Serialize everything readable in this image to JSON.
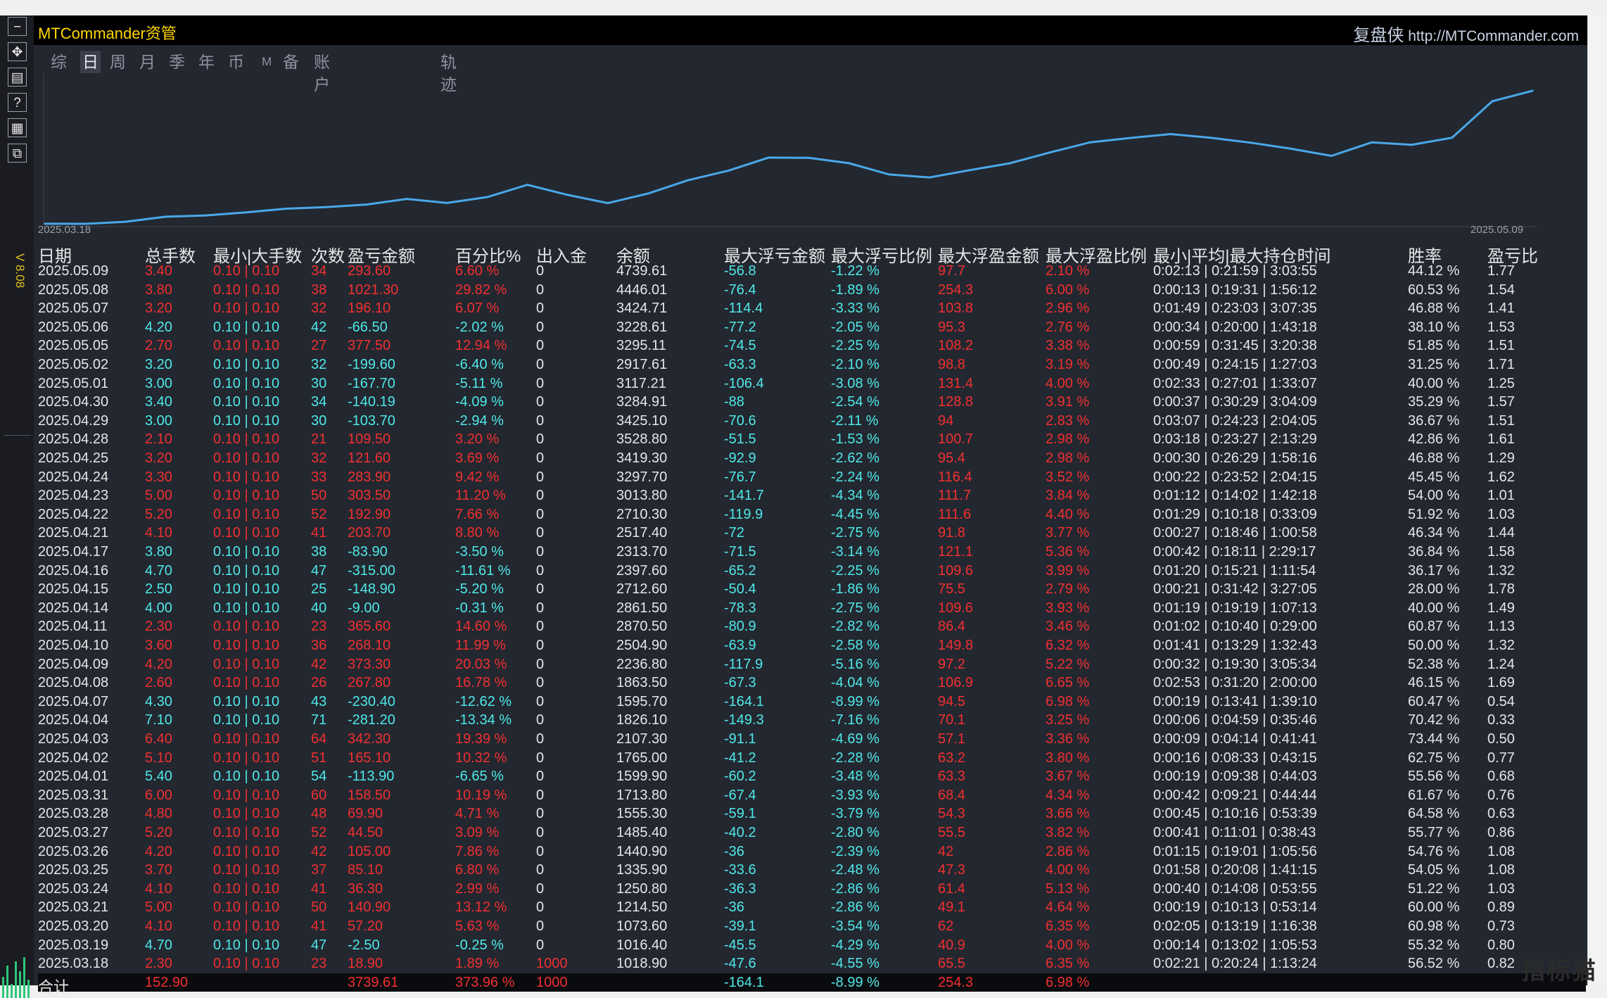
{
  "app": {
    "title": "MTCommander资管",
    "brand_name": "复盘侠",
    "brand_url": "http://MTCommander.com",
    "version": "V 8.08",
    "watermark": "指标猫"
  },
  "toolbar": [
    {
      "name": "minimize-icon",
      "glyph": "−"
    },
    {
      "name": "move-icon",
      "glyph": "✥"
    },
    {
      "name": "list-icon",
      "glyph": "▤"
    },
    {
      "name": "help-icon",
      "glyph": "?"
    },
    {
      "name": "grid-icon",
      "glyph": "▦"
    },
    {
      "name": "window-icon",
      "glyph": "⧉"
    }
  ],
  "tabs": [
    {
      "label": "综",
      "active": false
    },
    {
      "label": "日",
      "active": true
    },
    {
      "label": "周",
      "active": false
    },
    {
      "label": "月",
      "active": false
    },
    {
      "label": "季",
      "active": false
    },
    {
      "label": "年",
      "active": false
    },
    {
      "label": "币",
      "active": false
    },
    {
      "label": "M",
      "active": false
    },
    {
      "label": "备",
      "active": false
    },
    {
      "label": "账户",
      "active": false
    },
    {
      "label": "轨迹",
      "active": false
    }
  ],
  "chart_data": {
    "type": "line",
    "x_start_label": "2025.03.18",
    "x_end_label": "2025.05.09",
    "x": [
      "2025.03.18",
      "2025.03.19",
      "2025.03.20",
      "2025.03.21",
      "2025.03.24",
      "2025.03.25",
      "2025.03.26",
      "2025.03.27",
      "2025.03.28",
      "2025.03.31",
      "2025.04.01",
      "2025.04.02",
      "2025.04.03",
      "2025.04.04",
      "2025.04.07",
      "2025.04.08",
      "2025.04.09",
      "2025.04.10",
      "2025.04.11",
      "2025.04.14",
      "2025.04.15",
      "2025.04.16",
      "2025.04.17",
      "2025.04.21",
      "2025.04.22",
      "2025.04.23",
      "2025.04.24",
      "2025.04.25",
      "2025.04.28",
      "2025.04.29",
      "2025.04.30",
      "2025.05.01",
      "2025.05.02",
      "2025.05.05",
      "2025.05.06",
      "2025.05.07",
      "2025.05.08",
      "2025.05.09"
    ],
    "values": [
      1018.9,
      1016.4,
      1073.6,
      1214.5,
      1250.8,
      1335.9,
      1440.9,
      1485.4,
      1555.3,
      1713.8,
      1599.9,
      1765.0,
      2107.3,
      1826.1,
      1595.7,
      1863.5,
      2236.8,
      2504.9,
      2870.5,
      2861.5,
      2712.6,
      2397.6,
      2313.7,
      2517.4,
      2710.3,
      3013.8,
      3297.7,
      3419.3,
      3528.8,
      3425.1,
      3284.91,
      3117.21,
      2917.61,
      3295.11,
      3228.61,
      3424.71,
      4446.01,
      4739.61
    ],
    "line_color": "#4aa8e8",
    "grid": false
  },
  "table": {
    "headers": [
      "日期",
      "总手数",
      "最小|大手数",
      "次数",
      "盈亏金额",
      "百分比%",
      "出入金",
      "余额",
      "最大浮亏金额",
      "最大浮亏比例",
      "最大浮盈金额",
      "最大浮盈比例",
      "最小|平均|最大持仓时间",
      "胜率",
      "盈亏比"
    ],
    "rows": [
      [
        "2025.05.09",
        "3.40",
        "0.10 | 0.10",
        "34",
        "293.60",
        "6.60 %",
        "0",
        "4739.61",
        "-56.8",
        "-1.22 %",
        "97.7",
        "2.10 %",
        "0:02:13 | 0:21:59 | 3:03:55",
        "44.12 %",
        "1.77"
      ],
      [
        "2025.05.08",
        "3.80",
        "0.10 | 0.10",
        "38",
        "1021.30",
        "29.82 %",
        "0",
        "4446.01",
        "-76.4",
        "-1.89 %",
        "254.3",
        "6.00 %",
        "0:00:13 | 0:19:31 | 1:56:12",
        "60.53 %",
        "1.54"
      ],
      [
        "2025.05.07",
        "3.20",
        "0.10 | 0.10",
        "32",
        "196.10",
        "6.07 %",
        "0",
        "3424.71",
        "-114.4",
        "-3.33 %",
        "103.8",
        "2.96 %",
        "0:01:49 | 0:23:03 | 3:07:35",
        "46.88 %",
        "1.41"
      ],
      [
        "2025.05.06",
        "4.20",
        "0.10 | 0.10",
        "42",
        "-66.50",
        "-2.02 %",
        "0",
        "3228.61",
        "-77.2",
        "-2.05 %",
        "95.3",
        "2.76 %",
        "0:00:34 | 0:20:00 | 1:43:18",
        "38.10 %",
        "1.53"
      ],
      [
        "2025.05.05",
        "2.70",
        "0.10 | 0.10",
        "27",
        "377.50",
        "12.94 %",
        "0",
        "3295.11",
        "-74.5",
        "-2.25 %",
        "108.2",
        "3.38 %",
        "0:00:59 | 0:31:45 | 3:20:38",
        "51.85 %",
        "1.51"
      ],
      [
        "2025.05.02",
        "3.20",
        "0.10 | 0.10",
        "32",
        "-199.60",
        "-6.40 %",
        "0",
        "2917.61",
        "-63.3",
        "-2.10 %",
        "98.8",
        "3.19 %",
        "0:00:49 | 0:24:15 | 1:27:03",
        "31.25 %",
        "1.71"
      ],
      [
        "2025.05.01",
        "3.00",
        "0.10 | 0.10",
        "30",
        "-167.70",
        "-5.11 %",
        "0",
        "3117.21",
        "-106.4",
        "-3.08 %",
        "131.4",
        "4.00 %",
        "0:02:33 | 0:27:01 | 1:33:07",
        "40.00 %",
        "1.25"
      ],
      [
        "2025.04.30",
        "3.40",
        "0.10 | 0.10",
        "34",
        "-140.19",
        "-4.09 %",
        "0",
        "3284.91",
        "-88",
        "-2.54 %",
        "128.8",
        "3.91 %",
        "0:00:37 | 0:30:29 | 3:04:09",
        "35.29 %",
        "1.57"
      ],
      [
        "2025.04.29",
        "3.00",
        "0.10 | 0.10",
        "30",
        "-103.70",
        "-2.94 %",
        "0",
        "3425.10",
        "-70.6",
        "-2.11 %",
        "94",
        "2.83 %",
        "0:03:07 | 0:24:23 | 2:04:05",
        "36.67 %",
        "1.51"
      ],
      [
        "2025.04.28",
        "2.10",
        "0.10 | 0.10",
        "21",
        "109.50",
        "3.20 %",
        "0",
        "3528.80",
        "-51.5",
        "-1.53 %",
        "100.7",
        "2.98 %",
        "0:03:18 | 0:23:27 | 2:13:29",
        "42.86 %",
        "1.61"
      ],
      [
        "2025.04.25",
        "3.20",
        "0.10 | 0.10",
        "32",
        "121.60",
        "3.69 %",
        "0",
        "3419.30",
        "-92.9",
        "-2.62 %",
        "95.4",
        "2.98 %",
        "0:00:30 | 0:26:29 | 1:58:16",
        "46.88 %",
        "1.29"
      ],
      [
        "2025.04.24",
        "3.30",
        "0.10 | 0.10",
        "33",
        "283.90",
        "9.42 %",
        "0",
        "3297.70",
        "-76.7",
        "-2.24 %",
        "116.4",
        "3.52 %",
        "0:00:22 | 0:23:52 | 2:04:15",
        "45.45 %",
        "1.62"
      ],
      [
        "2025.04.23",
        "5.00",
        "0.10 | 0.10",
        "50",
        "303.50",
        "11.20 %",
        "0",
        "3013.80",
        "-141.7",
        "-4.34 %",
        "111.7",
        "3.84 %",
        "0:01:12 | 0:14:02 | 1:42:18",
        "54.00 %",
        "1.01"
      ],
      [
        "2025.04.22",
        "5.20",
        "0.10 | 0.10",
        "52",
        "192.90",
        "7.66 %",
        "0",
        "2710.30",
        "-119.9",
        "-4.45 %",
        "111.6",
        "4.40 %",
        "0:01:29 | 0:10:18 | 0:33:09",
        "51.92 %",
        "1.03"
      ],
      [
        "2025.04.21",
        "4.10",
        "0.10 | 0.10",
        "41",
        "203.70",
        "8.80 %",
        "0",
        "2517.40",
        "-72",
        "-2.75 %",
        "91.8",
        "3.77 %",
        "0:00:27 | 0:18:46 | 1:00:58",
        "46.34 %",
        "1.44"
      ],
      [
        "2025.04.17",
        "3.80",
        "0.10 | 0.10",
        "38",
        "-83.90",
        "-3.50 %",
        "0",
        "2313.70",
        "-71.5",
        "-3.14 %",
        "121.1",
        "5.36 %",
        "0:00:42 | 0:18:11 | 2:29:17",
        "36.84 %",
        "1.58"
      ],
      [
        "2025.04.16",
        "4.70",
        "0.10 | 0.10",
        "47",
        "-315.00",
        "-11.61 %",
        "0",
        "2397.60",
        "-65.2",
        "-2.25 %",
        "109.6",
        "3.99 %",
        "0:01:20 | 0:15:21 | 1:11:54",
        "36.17 %",
        "1.32"
      ],
      [
        "2025.04.15",
        "2.50",
        "0.10 | 0.10",
        "25",
        "-148.90",
        "-5.20 %",
        "0",
        "2712.60",
        "-50.4",
        "-1.86 %",
        "75.5",
        "2.79 %",
        "0:00:21 | 0:31:42 | 3:27:05",
        "28.00 %",
        "1.78"
      ],
      [
        "2025.04.14",
        "4.00",
        "0.10 | 0.10",
        "40",
        "-9.00",
        "-0.31 %",
        "0",
        "2861.50",
        "-78.3",
        "-2.75 %",
        "109.6",
        "3.93 %",
        "0:01:19 | 0:19:19 | 1:07:13",
        "40.00 %",
        "1.49"
      ],
      [
        "2025.04.11",
        "2.30",
        "0.10 | 0.10",
        "23",
        "365.60",
        "14.60 %",
        "0",
        "2870.50",
        "-80.9",
        "-2.82 %",
        "86.4",
        "3.46 %",
        "0:01:02 | 0:10:40 | 0:29:00",
        "60.87 %",
        "1.13"
      ],
      [
        "2025.04.10",
        "3.60",
        "0.10 | 0.10",
        "36",
        "268.10",
        "11.99 %",
        "0",
        "2504.90",
        "-63.9",
        "-2.58 %",
        "149.8",
        "6.32 %",
        "0:01:41 | 0:13:29 | 1:32:43",
        "50.00 %",
        "1.32"
      ],
      [
        "2025.04.09",
        "4.20",
        "0.10 | 0.10",
        "42",
        "373.30",
        "20.03 %",
        "0",
        "2236.80",
        "-117.9",
        "-5.16 %",
        "97.2",
        "5.22 %",
        "0:00:32 | 0:19:30 | 3:05:34",
        "52.38 %",
        "1.24"
      ],
      [
        "2025.04.08",
        "2.60",
        "0.10 | 0.10",
        "26",
        "267.80",
        "16.78 %",
        "0",
        "1863.50",
        "-67.3",
        "-4.04 %",
        "106.9",
        "6.65 %",
        "0:02:53 | 0:31:20 | 2:00:00",
        "46.15 %",
        "1.69"
      ],
      [
        "2025.04.07",
        "4.30",
        "0.10 | 0.10",
        "43",
        "-230.40",
        "-12.62 %",
        "0",
        "1595.70",
        "-164.1",
        "-8.99 %",
        "94.5",
        "6.98 %",
        "0:00:19 | 0:13:41 | 1:39:10",
        "60.47 %",
        "0.54"
      ],
      [
        "2025.04.04",
        "7.10",
        "0.10 | 0.10",
        "71",
        "-281.20",
        "-13.34 %",
        "0",
        "1826.10",
        "-149.3",
        "-7.16 %",
        "70.1",
        "3.25 %",
        "0:00:06 | 0:04:59 | 0:35:46",
        "70.42 %",
        "0.33"
      ],
      [
        "2025.04.03",
        "6.40",
        "0.10 | 0.10",
        "64",
        "342.30",
        "19.39 %",
        "0",
        "2107.30",
        "-91.1",
        "-4.69 %",
        "57.1",
        "3.36 %",
        "0:00:09 | 0:04:14 | 0:41:41",
        "73.44 %",
        "0.50"
      ],
      [
        "2025.04.02",
        "5.10",
        "0.10 | 0.10",
        "51",
        "165.10",
        "10.32 %",
        "0",
        "1765.00",
        "-41.2",
        "-2.28 %",
        "63.2",
        "3.80 %",
        "0:00:16 | 0:08:33 | 0:43:15",
        "62.75 %",
        "0.77"
      ],
      [
        "2025.04.01",
        "5.40",
        "0.10 | 0.10",
        "54",
        "-113.90",
        "-6.65 %",
        "0",
        "1599.90",
        "-60.2",
        "-3.48 %",
        "63.3",
        "3.67 %",
        "0:00:19 | 0:09:38 | 0:44:03",
        "55.56 %",
        "0.68"
      ],
      [
        "2025.03.31",
        "6.00",
        "0.10 | 0.10",
        "60",
        "158.50",
        "10.19 %",
        "0",
        "1713.80",
        "-67.4",
        "-3.93 %",
        "68.4",
        "4.34 %",
        "0:00:42 | 0:09:21 | 0:44:44",
        "61.67 %",
        "0.76"
      ],
      [
        "2025.03.28",
        "4.80",
        "0.10 | 0.10",
        "48",
        "69.90",
        "4.71 %",
        "0",
        "1555.30",
        "-59.1",
        "-3.79 %",
        "54.3",
        "3.66 %",
        "0:00:45 | 0:10:16 | 0:53:39",
        "64.58 %",
        "0.63"
      ],
      [
        "2025.03.27",
        "5.20",
        "0.10 | 0.10",
        "52",
        "44.50",
        "3.09 %",
        "0",
        "1485.40",
        "-40.2",
        "-2.80 %",
        "55.5",
        "3.82 %",
        "0:00:41 | 0:11:01 | 0:38:43",
        "55.77 %",
        "0.86"
      ],
      [
        "2025.03.26",
        "4.20",
        "0.10 | 0.10",
        "42",
        "105.00",
        "7.86 %",
        "0",
        "1440.90",
        "-36",
        "-2.39 %",
        "42",
        "2.86 %",
        "0:01:15 | 0:19:01 | 1:05:56",
        "54.76 %",
        "1.08"
      ],
      [
        "2025.03.25",
        "3.70",
        "0.10 | 0.10",
        "37",
        "85.10",
        "6.80 %",
        "0",
        "1335.90",
        "-33.6",
        "-2.48 %",
        "47.3",
        "4.00 %",
        "0:01:58 | 0:20:08 | 1:41:15",
        "54.05 %",
        "1.08"
      ],
      [
        "2025.03.24",
        "4.10",
        "0.10 | 0.10",
        "41",
        "36.30",
        "2.99 %",
        "0",
        "1250.80",
        "-36.3",
        "-2.86 %",
        "61.4",
        "5.13 %",
        "0:00:40 | 0:14:08 | 0:53:55",
        "51.22 %",
        "1.03"
      ],
      [
        "2025.03.21",
        "5.00",
        "0.10 | 0.10",
        "50",
        "140.90",
        "13.12 %",
        "0",
        "1214.50",
        "-36",
        "-2.86 %",
        "49.1",
        "4.64 %",
        "0:00:19 | 0:10:13 | 0:53:14",
        "60.00 %",
        "0.89"
      ],
      [
        "2025.03.20",
        "4.10",
        "0.10 | 0.10",
        "41",
        "57.20",
        "5.63 %",
        "0",
        "1073.60",
        "-39.1",
        "-3.54 %",
        "62",
        "6.35 %",
        "0:02:05 | 0:13:19 | 1:16:38",
        "60.98 %",
        "0.73"
      ],
      [
        "2025.03.19",
        "4.70",
        "0.10 | 0.10",
        "47",
        "-2.50",
        "-0.25 %",
        "0",
        "1016.40",
        "-45.5",
        "-4.29 %",
        "40.9",
        "4.00 %",
        "0:00:14 | 0:13:02 | 1:05:53",
        "55.32 %",
        "0.80"
      ],
      [
        "2025.03.18",
        "2.30",
        "0.10 | 0.10",
        "23",
        "18.90",
        "1.89 %",
        "1000",
        "1018.90",
        "-47.6",
        "-4.55 %",
        "65.5",
        "6.35 %",
        "0:02:21 | 0:20:24 | 1:13:24",
        "56.52 %",
        "0.82"
      ]
    ],
    "total": [
      "合计",
      "152.90",
      "",
      "",
      "3739.61",
      "373.96 %",
      "1000",
      "",
      "-164.1",
      "-8.99 %",
      "254.3",
      "6.98 %",
      "",
      "",
      ""
    ]
  },
  "colors": {
    "up": "#f03030",
    "down": "#4fe8e8",
    "neutral": "#e6e6e6",
    "title": "#ffd700"
  }
}
